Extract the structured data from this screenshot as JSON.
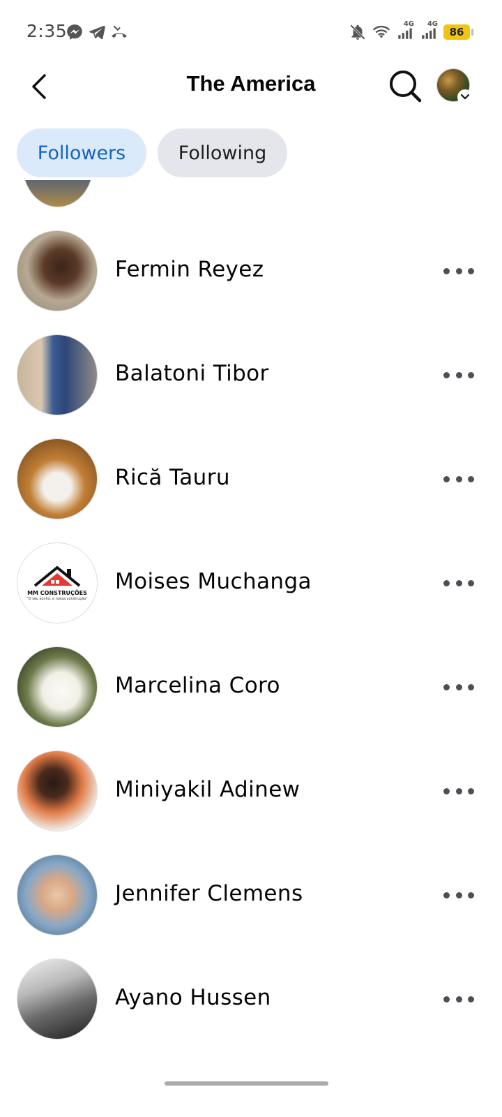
{
  "status_bar": {
    "time": "2:35",
    "left_icons": [
      "messenger-icon",
      "telegram-icon",
      "missed-call-icon"
    ],
    "right_icons": [
      "notifications-off-icon",
      "wifi-icon",
      "signal-4g-icon",
      "signal-4g-icon"
    ],
    "network_label_1": "4G",
    "network_label_2": "4G",
    "battery_level": "86",
    "battery_color": "#f1c40f"
  },
  "header": {
    "title": "The America",
    "back_icon": "chevron-left-icon",
    "search_icon": "search-icon",
    "profile_icon": "avatar"
  },
  "tabs": [
    {
      "label": "Followers",
      "active": true
    },
    {
      "label": "Following",
      "active": false
    }
  ],
  "colors": {
    "active_tab_bg": "#dbeafb",
    "active_tab_text": "#1565c0",
    "inactive_tab_bg": "#e4e6eb",
    "text_primary": "#050505",
    "more_dots": "#4b4f56"
  },
  "followers": [
    {
      "name": "Fermin Reyez"
    },
    {
      "name": "Balatoni Tibor"
    },
    {
      "name": "Rică Tauru"
    },
    {
      "name": "Moises Muchanga",
      "avatar_logo": {
        "name": "MM CONSTRUÇÕES",
        "tagline": "\"O seu sonho, a nossa construção\""
      }
    },
    {
      "name": "Marcelina Coro"
    },
    {
      "name": "Miniyakil Adinew"
    },
    {
      "name": "Jennifer Clemens"
    },
    {
      "name": "Ayano Hussen"
    }
  ]
}
